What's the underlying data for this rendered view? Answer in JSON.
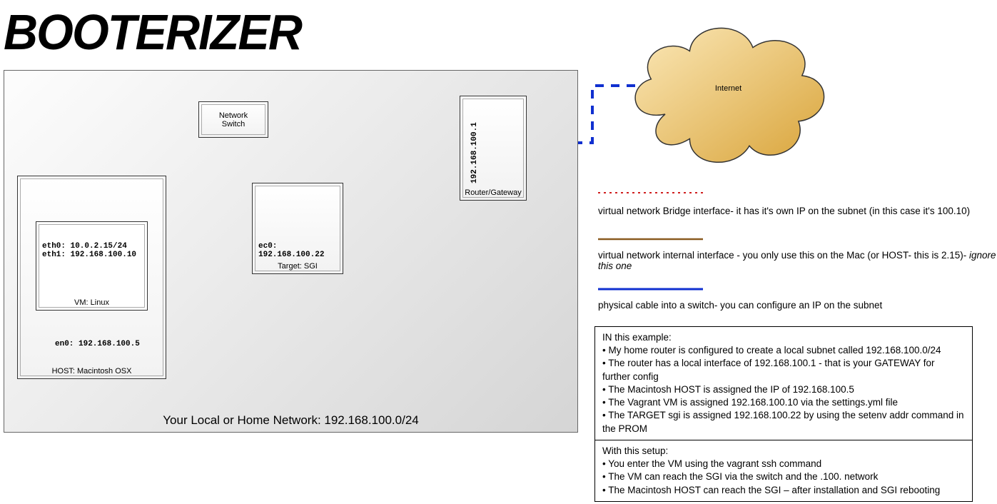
{
  "title": "BOOTERIZER",
  "network_caption": "Your Local or Home Network: 192.168.100.0/24",
  "nodes": {
    "switch": {
      "label": "Network\nSwitch"
    },
    "router": {
      "label": "Router/Gateway",
      "ip": "192.168.100.1"
    },
    "host": {
      "label": "HOST: Macintosh OSX",
      "en0": "en0: 192.168.100.5"
    },
    "vm": {
      "label": "VM: Linux",
      "eth0": "eth0: 10.0.2.15/24",
      "eth1": "eth1: 192.168.100.10"
    },
    "target": {
      "label": "Target: SGI",
      "ec0": "ec0: 192.168.100.22"
    },
    "internet": "Internet"
  },
  "legend": {
    "bridge": "virtual network Bridge interface- it has it's own IP on the subnet (in this case it's 100.10)",
    "internal": "virtual network internal interface - you only use this on the Mac (or HOST- this is 2.15)-",
    "internal_em": " ignore this one",
    "physical": "physical cable into a switch- you can configure an IP on the subnet"
  },
  "info1": {
    "head": "IN this example:",
    "b1": "• My home router is configured to create a local subnet called 192.168.100.0/24",
    "b2": "• The router has a local interface of 192.168.100.1 - that is your GATEWAY for further config",
    "b3": "• The Macintosh HOST is assigned the IP of 192.168.100.5",
    "b4": "• The Vagrant VM is assigned 192.168.100.10 via the settings.yml file",
    "b5": "• The TARGET sgi is assigned 192.168.100.22 by using the setenv addr command in the PROM"
  },
  "info2": {
    "head": "With this setup:",
    "b1": "• You enter the VM using the vagrant ssh command",
    "b2": "• The VM can reach the SGI via the switch and the .100. network",
    "b3": "• The Macintosh HOST can reach the SGI – after installation and SGI rebooting"
  }
}
